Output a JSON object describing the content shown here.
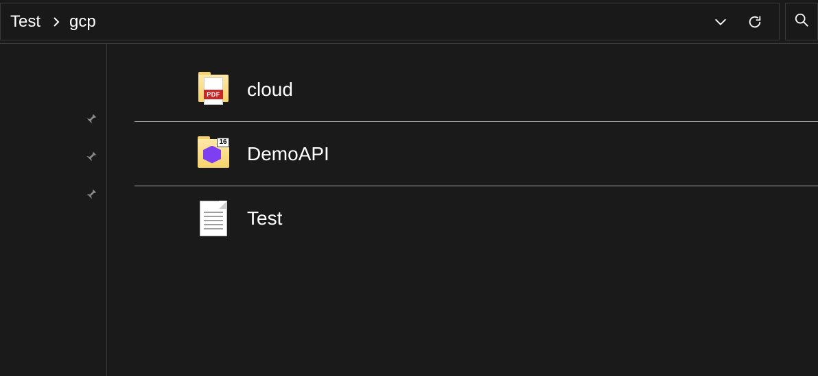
{
  "breadcrumb": {
    "items": [
      {
        "label": "Test"
      },
      {
        "label": "gcp"
      }
    ]
  },
  "items": [
    {
      "name": "cloud",
      "icon": "pdf-folder",
      "pdf_label": "PDF"
    },
    {
      "name": "DemoAPI",
      "icon": "vs-folder",
      "version_badge": "16"
    },
    {
      "name": "Test",
      "icon": "text-document"
    }
  ],
  "pins": [
    {
      "label": "pin"
    },
    {
      "label": "pin"
    },
    {
      "label": "pin"
    }
  ]
}
